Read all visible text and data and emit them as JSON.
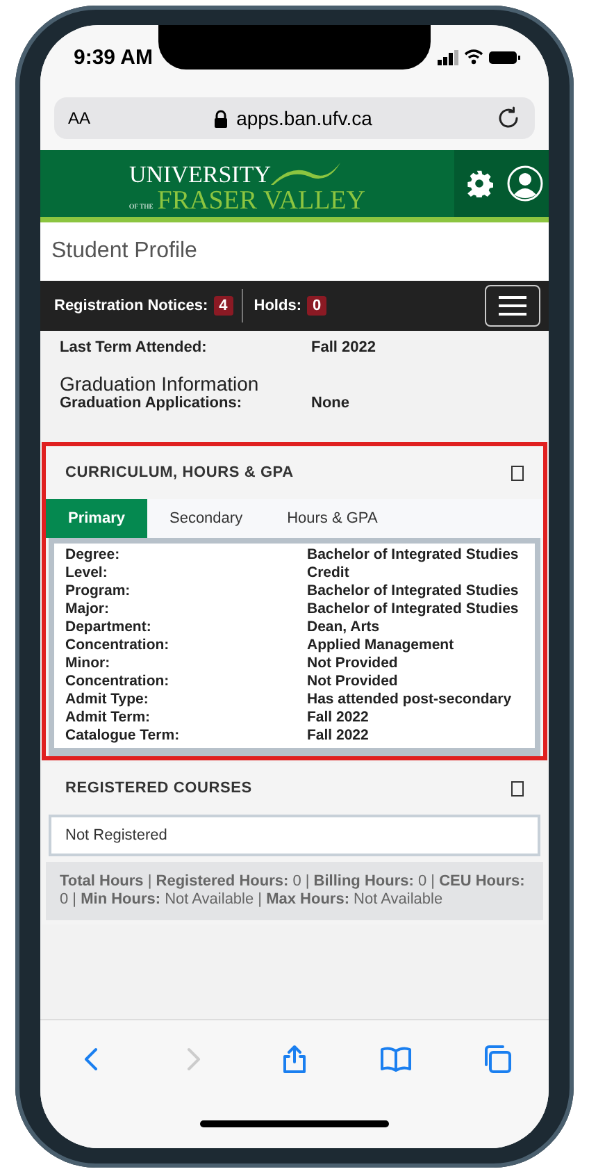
{
  "status_bar": {
    "time": "9:39 AM"
  },
  "browser": {
    "text_size": "AA",
    "url": "apps.ban.ufv.ca"
  },
  "header": {
    "logo": {
      "line_1": "UNIVERSITY",
      "small": "OF THE",
      "line_2": "FRASER VALLEY"
    }
  },
  "page_title": "Student Profile",
  "notices_bar": [
    {
      "label": "Registration Notices:",
      "count": "4"
    },
    {
      "label": "Holds:",
      "count": "0"
    }
  ],
  "term_info": [
    {
      "label": "Last Term Attended:",
      "value": "Fall 2022"
    }
  ],
  "graduation": {
    "title": "Graduation Information",
    "rows": [
      {
        "label": "Graduation Applications:",
        "value": "None"
      }
    ]
  },
  "curriculum": {
    "title": "CURRICULUM, HOURS & GPA",
    "highlighted": true,
    "tabs": [
      {
        "label": "Primary",
        "selected": true
      },
      {
        "label": "Secondary",
        "selected": false
      },
      {
        "label": "Hours & GPA",
        "selected": false
      }
    ],
    "rows": [
      {
        "label": "Degree:",
        "value": "Bachelor of Integrated Studies"
      },
      {
        "label": "Level:",
        "value": "Credit"
      },
      {
        "label": "Program:",
        "value": "Bachelor of Integrated Studies"
      },
      {
        "label": "Major:",
        "value": "Bachelor of Integrated Studies"
      },
      {
        "label": "Department:",
        "value": "Dean, Arts"
      },
      {
        "label": "Concentration:",
        "value": "Applied Management"
      },
      {
        "label": "Minor:",
        "value": "Not Provided"
      },
      {
        "label": "Concentration:",
        "value": "Not Provided"
      },
      {
        "label": "Admit Type:",
        "value": "Has attended post-secondary"
      },
      {
        "label": "Admit Term:",
        "value": "Fall 2022"
      },
      {
        "label": "Catalogue Term:",
        "value": "Fall 2022"
      }
    ]
  },
  "registered_courses": {
    "title": "REGISTERED COURSES",
    "highlighted": false,
    "message": "Not Registered",
    "summary": "**Total Hours** |  **Registered Hours:**  0  |  **Billing Hours:**  0  |  **CEU Hours:**  0  | **Min Hours:**  Not Available  |  **Max Hours:**  Not Available"
  }
}
